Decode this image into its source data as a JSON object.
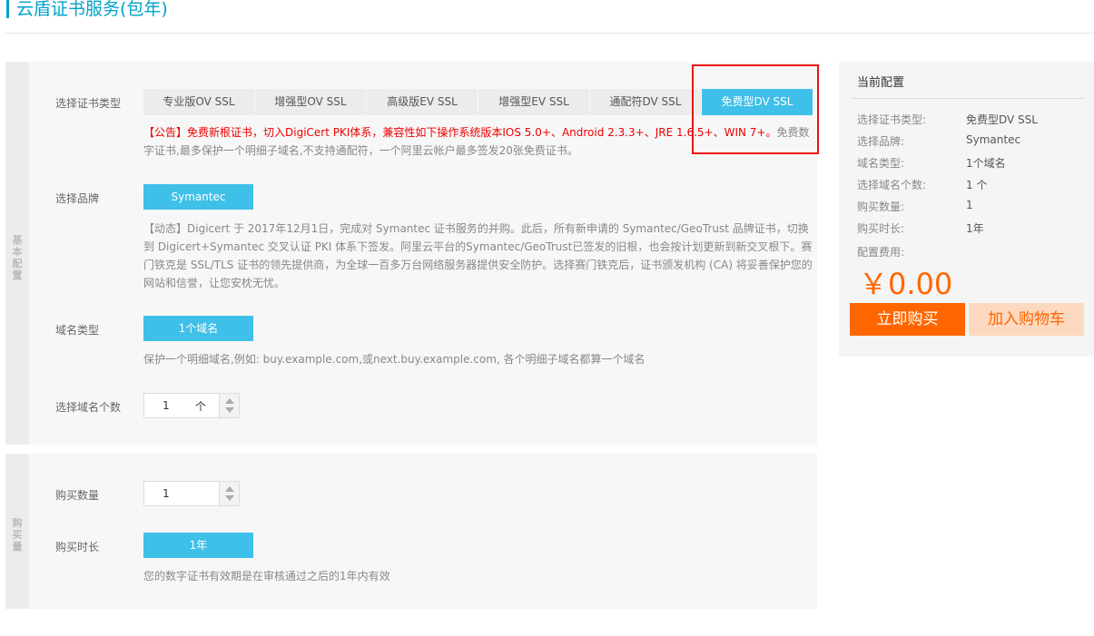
{
  "page": {
    "title": "云盾证书服务(包年)"
  },
  "colors": {
    "accent": "#3fc0e8",
    "title": "#00a2ca",
    "buy": "#ff6600",
    "highlight": "#ee1111"
  },
  "basic": {
    "side_label": "基本配置",
    "cert_type": {
      "label": "选择证书类型",
      "options": [
        "专业版OV SSL",
        "增强型OV SSL",
        "高级版EV SSL",
        "增强型EV SSL",
        "通配符DV SSL",
        "免费型DV SSL"
      ],
      "selected": "免费型DV SSL",
      "notice_red": "【公告】免费新根证书，切入DigiCert PKI体系，兼容性如下操作系统版本IOS 5.0+、Android 2.3.3+、JRE 1.6.5+、WIN 7+。",
      "notice_gray": "免费数字证书,最多保护一个明细子域名,不支持通配符，一个阿里云帐户最多签发20张免费证书。"
    },
    "brand": {
      "label": "选择品牌",
      "value": "Symantec",
      "desc": "【动态】Digicert 于 2017年12月1日，完成对 Symantec 证书服务的并购。此后，所有新申请的 Symantec/GeoTrust 品牌证书，切换到 Digicert+Symantec 交叉认证 PKI 体系下签发。阿里云平台的Symantec/GeoTrust已签发的旧根，也会按计划更新到新交叉根下。赛门铁克是 SSL/TLS 证书的领先提供商，为全球一百多万台网络服务器提供安全防护。选择赛门铁克后，证书颁发机构 (CA) 将妥善保护您的网站和信誉，让您安枕无忧。"
    },
    "domain_type": {
      "label": "域名类型",
      "value": "1个域名",
      "desc": "保护一个明细域名,例如: buy.example.com,或next.buy.example.com, 各个明细子域名都算一个域名"
    },
    "domain_count": {
      "label": "选择域名个数",
      "value": "1",
      "unit": "个"
    }
  },
  "purchase": {
    "side_label": "购买量",
    "quantity": {
      "label": "购买数量",
      "value": "1"
    },
    "duration": {
      "label": "购买时长",
      "value": "1年",
      "desc": "您的数字证书有效期是在审核通过之后的1年内有效"
    }
  },
  "summary": {
    "title": "当前配置",
    "rows": [
      {
        "label": "选择证书类型:",
        "value": "免费型DV SSL"
      },
      {
        "label": "选择品牌:",
        "value": "Symantec"
      },
      {
        "label": "域名类型:",
        "value": "1个域名"
      },
      {
        "label": "选择域名个数:",
        "value": "1 个"
      },
      {
        "label": "购买数量:",
        "value": "1"
      },
      {
        "label": "购买时长:",
        "value": "1年"
      }
    ],
    "fee_label": "配置费用:",
    "price": "￥0.00",
    "buy_label": "立即购买",
    "cart_label": "加入购物车"
  }
}
